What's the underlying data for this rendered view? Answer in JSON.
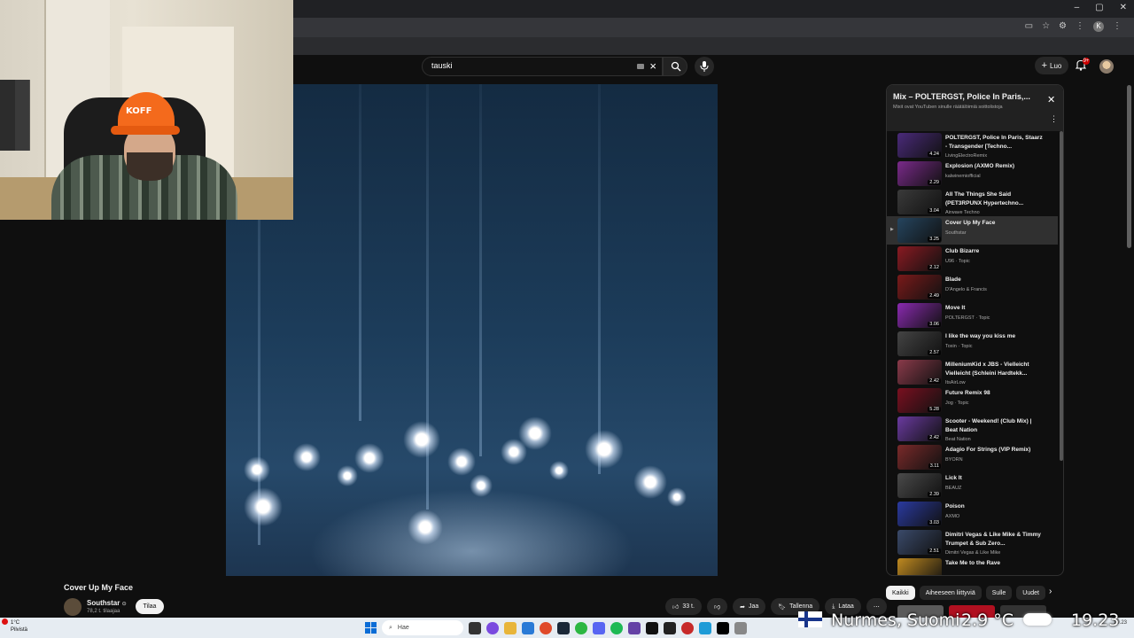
{
  "header": {
    "search_value": "tauski",
    "create_label": "Luo",
    "notifications_count": "9+"
  },
  "browser": {
    "window_controls": [
      "–",
      "▢",
      "✕"
    ],
    "profile_initial": "K"
  },
  "webcam": {
    "cap_text": "KOFF"
  },
  "video": {
    "title": "Cover Up My Face",
    "channel": "Southstar",
    "subscribers": "78,2 t. tilaajaa",
    "subscribe_label": "Tilaa",
    "like_count": "33 t.",
    "share_label": "Jaa",
    "save_label": "Tallenna",
    "download_label": "Lataa"
  },
  "playlist": {
    "title": "Mix – POLTERGST, Police In Paris,...",
    "subtitle": "Mixit ovat YouTuben sinulle räätälöimiä soittolistoja",
    "items": [
      {
        "title": "POLTERGST, Police In Paris, Staarz - Transgender [Techno...",
        "channel": "LivingElectroRemix",
        "duration": "4.24",
        "color": "#4a2a7a"
      },
      {
        "title": "Explosion (AXMO Remix)",
        "channel": "kalwinemiofficial",
        "duration": "2.29",
        "color": "#7a2a8a"
      },
      {
        "title": "All The Things She Said (PET3RPUNX Hypertechno...",
        "channel": "Airwave Techno",
        "duration": "3.04",
        "color": "#3a3a3a"
      },
      {
        "title": "Cover Up My Face",
        "channel": "Southstar",
        "duration": "3.25",
        "color": "#25455f"
      },
      {
        "title": "Club Bizarre",
        "channel": "U96 · Topic",
        "duration": "2.12",
        "color": "#8a1a22"
      },
      {
        "title": "Blade",
        "channel": "D'Angelo & Francis",
        "duration": "2.49",
        "color": "#7a1a1a"
      },
      {
        "title": "Move It",
        "channel": "POLTERGST · Topic",
        "duration": "3.06",
        "color": "#8a2ab0"
      },
      {
        "title": "I like the way you kiss me",
        "channel": "Toxin · Topic",
        "duration": "2.57",
        "color": "#444444"
      },
      {
        "title": "MilleniumKid x JBS - Vielleicht Vielleicht (Schleini Hardtekk...",
        "channel": "ItsAirLow",
        "duration": "2.42",
        "color": "#8a3a4a"
      },
      {
        "title": "Future Remix 98",
        "channel": "Jog · Topic",
        "duration": "5.28",
        "color": "#7a1020"
      },
      {
        "title": "Scooter - Weekend! (Club Mix) | Beat Nation",
        "channel": "Beat Nation",
        "duration": "2.42",
        "color": "#6a3aa0"
      },
      {
        "title": "Adagio For Strings (VIP Remix)",
        "channel": "BYORN",
        "duration": "3.11",
        "color": "#7a2a2a"
      },
      {
        "title": "Lick It",
        "channel": "BEAUZ",
        "duration": "2.39",
        "color": "#4a4a4a"
      },
      {
        "title": "Poison",
        "channel": "AXMO",
        "duration": "3.03",
        "color": "#2a3aa0"
      },
      {
        "title": "Dimitri Vegas & Like Mike & Timmy Trumpet & Sub Zero...",
        "channel": "Dimitri Vegas & Like Mike",
        "duration": "2.51",
        "color": "#3a4a6a"
      },
      {
        "title": "Take Me to the Rave",
        "channel": "",
        "duration": "",
        "color": "#c08a20"
      }
    ]
  },
  "chips": [
    "Kaikki",
    "Aiheeseen liittyviä",
    "Sulle",
    "Uudet"
  ],
  "taskbar": {
    "weather_temp": "1°C",
    "weather_desc": "Pilvistä",
    "search_placeholder": "Hae",
    "time": "19.23"
  },
  "overlay": {
    "location": "Nurmes, Suomi",
    "temperature": "2.9 °C",
    "time": "19.23"
  },
  "colors": {
    "yt_bg": "#0f0f0f",
    "accent_red": "#cc0000"
  }
}
